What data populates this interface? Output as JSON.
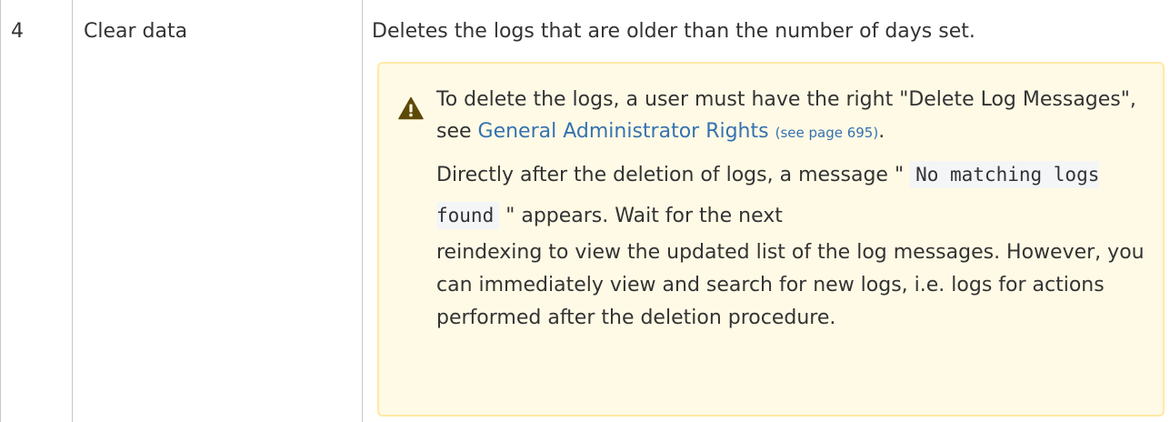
{
  "row": {
    "number": "4",
    "name": "Clear data",
    "description": "Deletes the logs that are older than the number of days set."
  },
  "note": {
    "icon": "warning-icon",
    "colors": {
      "background": "#fffae6",
      "border": "#ffe9a6",
      "icon": "#5e4a07",
      "link": "#3572b0"
    },
    "para1_before": "To delete the logs, a user must have the right \"Delete Log Messages\", see ",
    "link_text": "General Administrator Rights",
    "page_ref": "(see page 695)",
    "para1_after": ".",
    "para2_before": "Directly after the deletion of logs, a message \"",
    "code_text": "No matching logs found",
    "para2_after_quote": "\" appears. Wait for the next",
    "para2_rest": "reindexing to view the updated list of the log messages. However, you can immediately view and search for new logs, i.e. logs for actions performed after the deletion procedure."
  }
}
